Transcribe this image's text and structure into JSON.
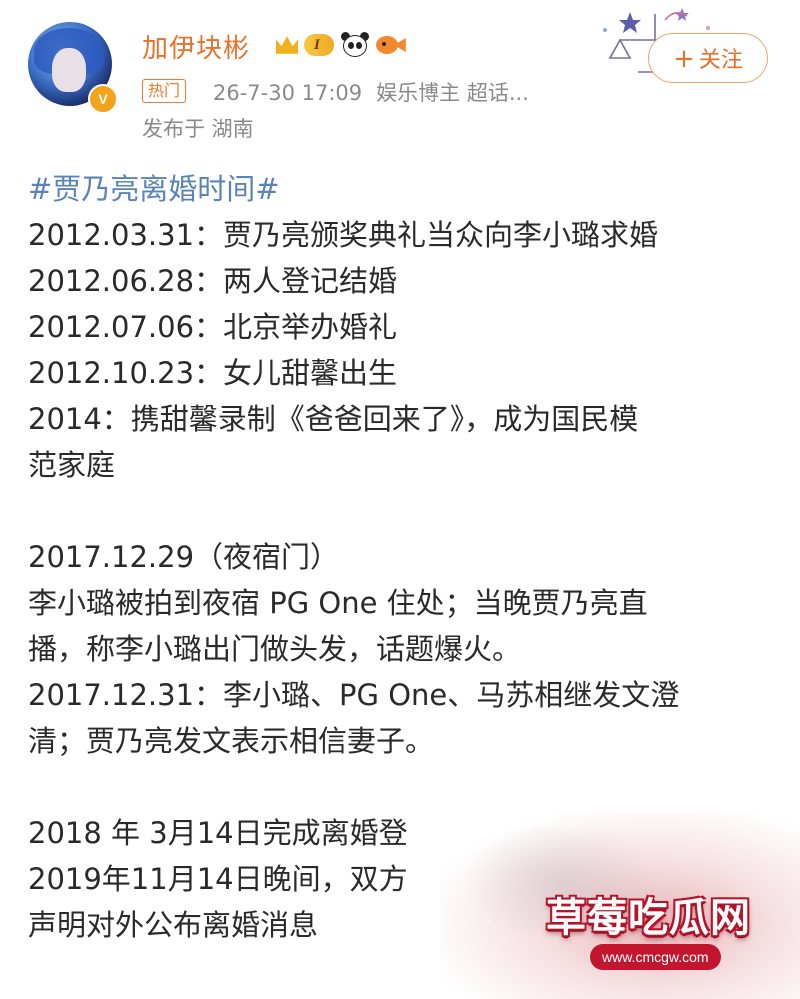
{
  "post": {
    "author": "加伊块彬",
    "level_badge": "I",
    "hot_tag": "热门",
    "timestamp": "26-7-30 17:09",
    "author_role": "娱乐博主 超话...",
    "location": "发布于 湖南",
    "follow_label": "关注",
    "follow_plus": "+"
  },
  "icons": {
    "avatar": "avatar-image",
    "vip": "vip-v-icon",
    "crown": "crown-icon",
    "panda": "panda-icon",
    "fish": "fish-icon",
    "decor": "zodiac-libra-decoration"
  },
  "content": {
    "hashtag": "#贾乃亮离婚时间#",
    "lines_block1": [
      "2012.03.31：贾乃亮颁奖典礼当众向李小璐求婚",
      "2012.06.28：两人登记结婚",
      "2012.07.06：北京举办婚礼",
      "2012.10.23：女儿甜馨出生",
      "2014：携甜馨录制《爸爸回来了》，成为国民模",
      "范家庭"
    ],
    "lines_block2": [
      "2017.12.29（夜宿门）",
      "李小璐被拍到夜宿 PG One 住处；当晚贾乃亮直",
      "播，称李小璐出门做头发，话题爆火。",
      "2017.12.31：李小璐、PG One、马苏相继发文澄",
      "清；贾乃亮发文表示相信妻子。"
    ],
    "lines_block3": [
      "2018 年 3月14日完成离婚登",
      "2019年11月14日晚间，双方",
      "声明对外公布离婚消息"
    ]
  },
  "watermark": {
    "title": "草莓吃瓜网",
    "url": "www.cmcgw.com"
  },
  "colors": {
    "author": "#e8702a",
    "hashtag": "#5a83b8",
    "meta": "#8a8a8a",
    "text": "#2a2a2a",
    "watermark_red": "#c2162f"
  }
}
